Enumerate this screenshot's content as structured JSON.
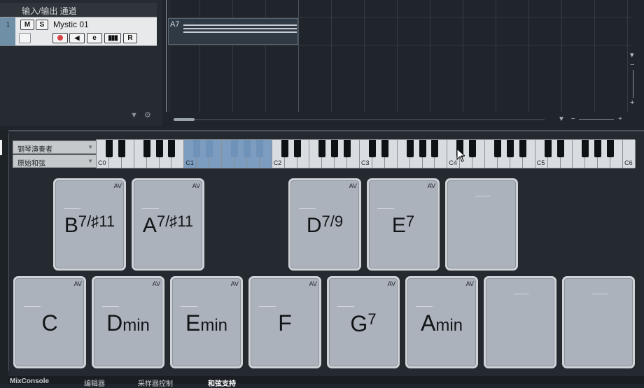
{
  "track_list": {
    "io_header": "输入/输出 通道",
    "track": {
      "number": "1",
      "name": "Mystic 01",
      "buttons": {
        "mute": "M",
        "solo": "S",
        "edit": "e",
        "read": "R"
      }
    }
  },
  "arrangement": {
    "clip_label": "A7"
  },
  "chord_pads": {
    "player_dropdown": "钢琴演奏者",
    "voicing_dropdown": "原始和弦",
    "keyboard_labels": [
      "C0",
      "C1",
      "C2",
      "C3",
      "C4",
      "C5",
      "C6"
    ],
    "av_label": "AV",
    "top_row": [
      {
        "root": "B",
        "ext": "7/♯11"
      },
      {
        "root": "A",
        "ext": "7/♯11"
      },
      {
        "root": "D",
        "ext": "7/9"
      },
      {
        "root": "E",
        "ext": "7"
      },
      {
        "root": "",
        "ext": ""
      }
    ],
    "bottom_row": [
      {
        "root": "C",
        "ext": ""
      },
      {
        "root": "D",
        "ext": "min"
      },
      {
        "root": "E",
        "ext": "min"
      },
      {
        "root": "F",
        "ext": ""
      },
      {
        "root": "G",
        "ext": "7"
      },
      {
        "root": "A",
        "ext": "min"
      },
      {
        "root": "",
        "ext": ""
      },
      {
        "root": "",
        "ext": ""
      }
    ]
  },
  "bottom_tabs": [
    "MixConsole",
    "编辑器",
    "采样器控制",
    "和弦支持"
  ],
  "colors": {
    "pad_fill": "#abb2bb",
    "highlight_key": "#7c9dc0",
    "record_red": "#d64545"
  }
}
